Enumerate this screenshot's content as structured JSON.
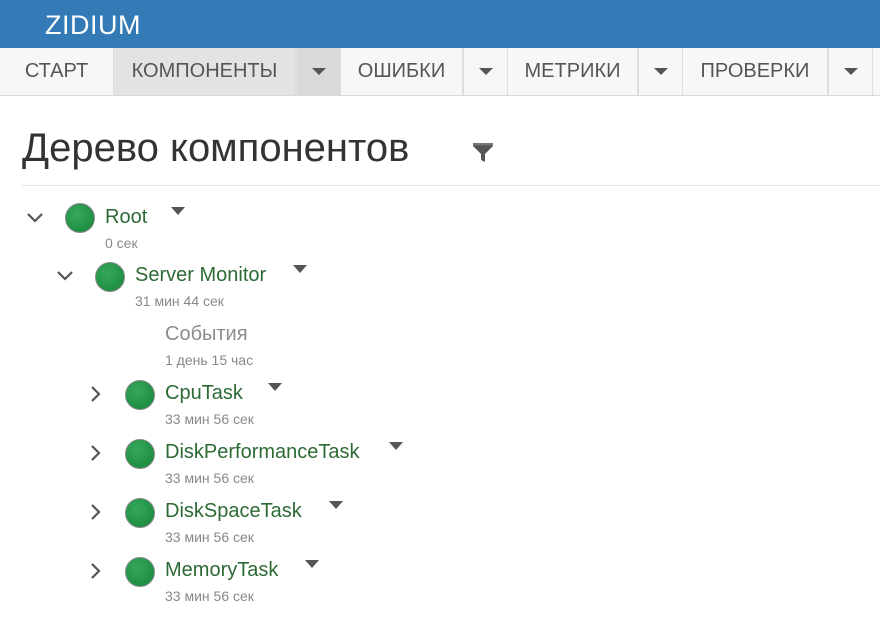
{
  "app": {
    "brand": "ZIDIUM"
  },
  "nav": {
    "items": [
      {
        "label": "СТАРТ"
      },
      {
        "label": "КОМПОНЕНТЫ"
      },
      {
        "label": "ОШИБКИ"
      },
      {
        "label": "МЕТРИКИ"
      },
      {
        "label": "ПРОВЕРКИ"
      }
    ],
    "active": "КОМПОНЕНТЫ"
  },
  "page": {
    "title": "Дерево компонентов"
  },
  "icons": {
    "filter": "filter-icon",
    "expanded": "chevron-down-icon",
    "collapsed": "chevron-right-icon",
    "menu": "caret-down-icon",
    "status": "status-dot-icon"
  },
  "colors": {
    "header": "#337ab7",
    "status_ok": "#229346",
    "link": "#2d6a35",
    "muted": "#888888"
  },
  "tree": {
    "root": {
      "name": "Root",
      "time": "0 сек",
      "expanded": true,
      "status": "ok"
    },
    "server": {
      "name": "Server Monitor",
      "time": "31 мин 44 сек",
      "expanded": true,
      "status": "ok"
    },
    "events": {
      "name": "События",
      "time": "1 день 15 час"
    },
    "children": [
      {
        "name": "CpuTask",
        "time": "33 мин 56 сек",
        "expanded": false,
        "status": "ok"
      },
      {
        "name": "DiskPerformanceTask",
        "time": "33 мин 56 сек",
        "expanded": false,
        "status": "ok"
      },
      {
        "name": "DiskSpaceTask",
        "time": "33 мин 56 сек",
        "expanded": false,
        "status": "ok"
      },
      {
        "name": "MemoryTask",
        "time": "33 мин 56 сек",
        "expanded": false,
        "status": "ok"
      }
    ]
  }
}
